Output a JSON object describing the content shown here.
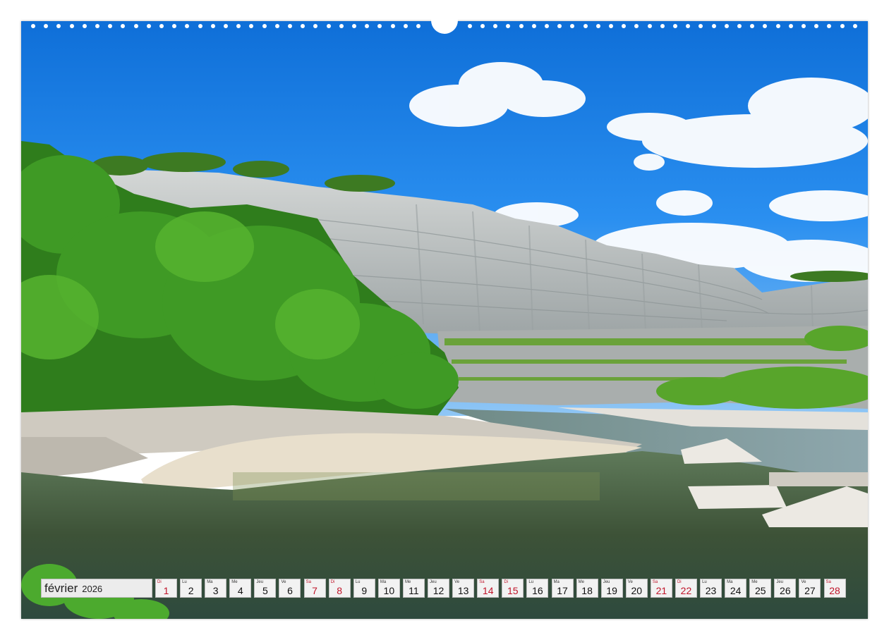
{
  "calendar": {
    "month": "février",
    "year": "2026",
    "days": [
      {
        "wd": "Di",
        "num": "1",
        "weekend": true
      },
      {
        "wd": "Lu",
        "num": "2",
        "weekend": false
      },
      {
        "wd": "Ma",
        "num": "3",
        "weekend": false
      },
      {
        "wd": "Me",
        "num": "4",
        "weekend": false
      },
      {
        "wd": "Jeu",
        "num": "5",
        "weekend": false
      },
      {
        "wd": "Ve",
        "num": "6",
        "weekend": false
      },
      {
        "wd": "Sa",
        "num": "7",
        "weekend": true
      },
      {
        "wd": "Di",
        "num": "8",
        "weekend": true
      },
      {
        "wd": "Lu",
        "num": "9",
        "weekend": false
      },
      {
        "wd": "Ma",
        "num": "10",
        "weekend": false
      },
      {
        "wd": "Me",
        "num": "11",
        "weekend": false
      },
      {
        "wd": "Jeu",
        "num": "12",
        "weekend": false
      },
      {
        "wd": "Ve",
        "num": "13",
        "weekend": false
      },
      {
        "wd": "Sa",
        "num": "14",
        "weekend": true
      },
      {
        "wd": "Di",
        "num": "15",
        "weekend": true
      },
      {
        "wd": "Lu",
        "num": "16",
        "weekend": false
      },
      {
        "wd": "Ma",
        "num": "17",
        "weekend": false
      },
      {
        "wd": "Me",
        "num": "18",
        "weekend": false
      },
      {
        "wd": "Jeu",
        "num": "19",
        "weekend": false
      },
      {
        "wd": "Ve",
        "num": "20",
        "weekend": false
      },
      {
        "wd": "Sa",
        "num": "21",
        "weekend": true
      },
      {
        "wd": "Di",
        "num": "22",
        "weekend": true
      },
      {
        "wd": "Lu",
        "num": "23",
        "weekend": false
      },
      {
        "wd": "Ma",
        "num": "24",
        "weekend": false
      },
      {
        "wd": "Me",
        "num": "25",
        "weekend": false
      },
      {
        "wd": "Jeu",
        "num": "26",
        "weekend": false
      },
      {
        "wd": "Ve",
        "num": "27",
        "weekend": false
      },
      {
        "wd": "Sa",
        "num": "28",
        "weekend": true
      }
    ]
  },
  "colors": {
    "sky": "#1e7fe0",
    "cliff": "#c9cdd0",
    "foliage": "#3f8f24",
    "water": "#3e5a3c",
    "sand": "#e9e1cf",
    "weekend": "#c0152a"
  }
}
